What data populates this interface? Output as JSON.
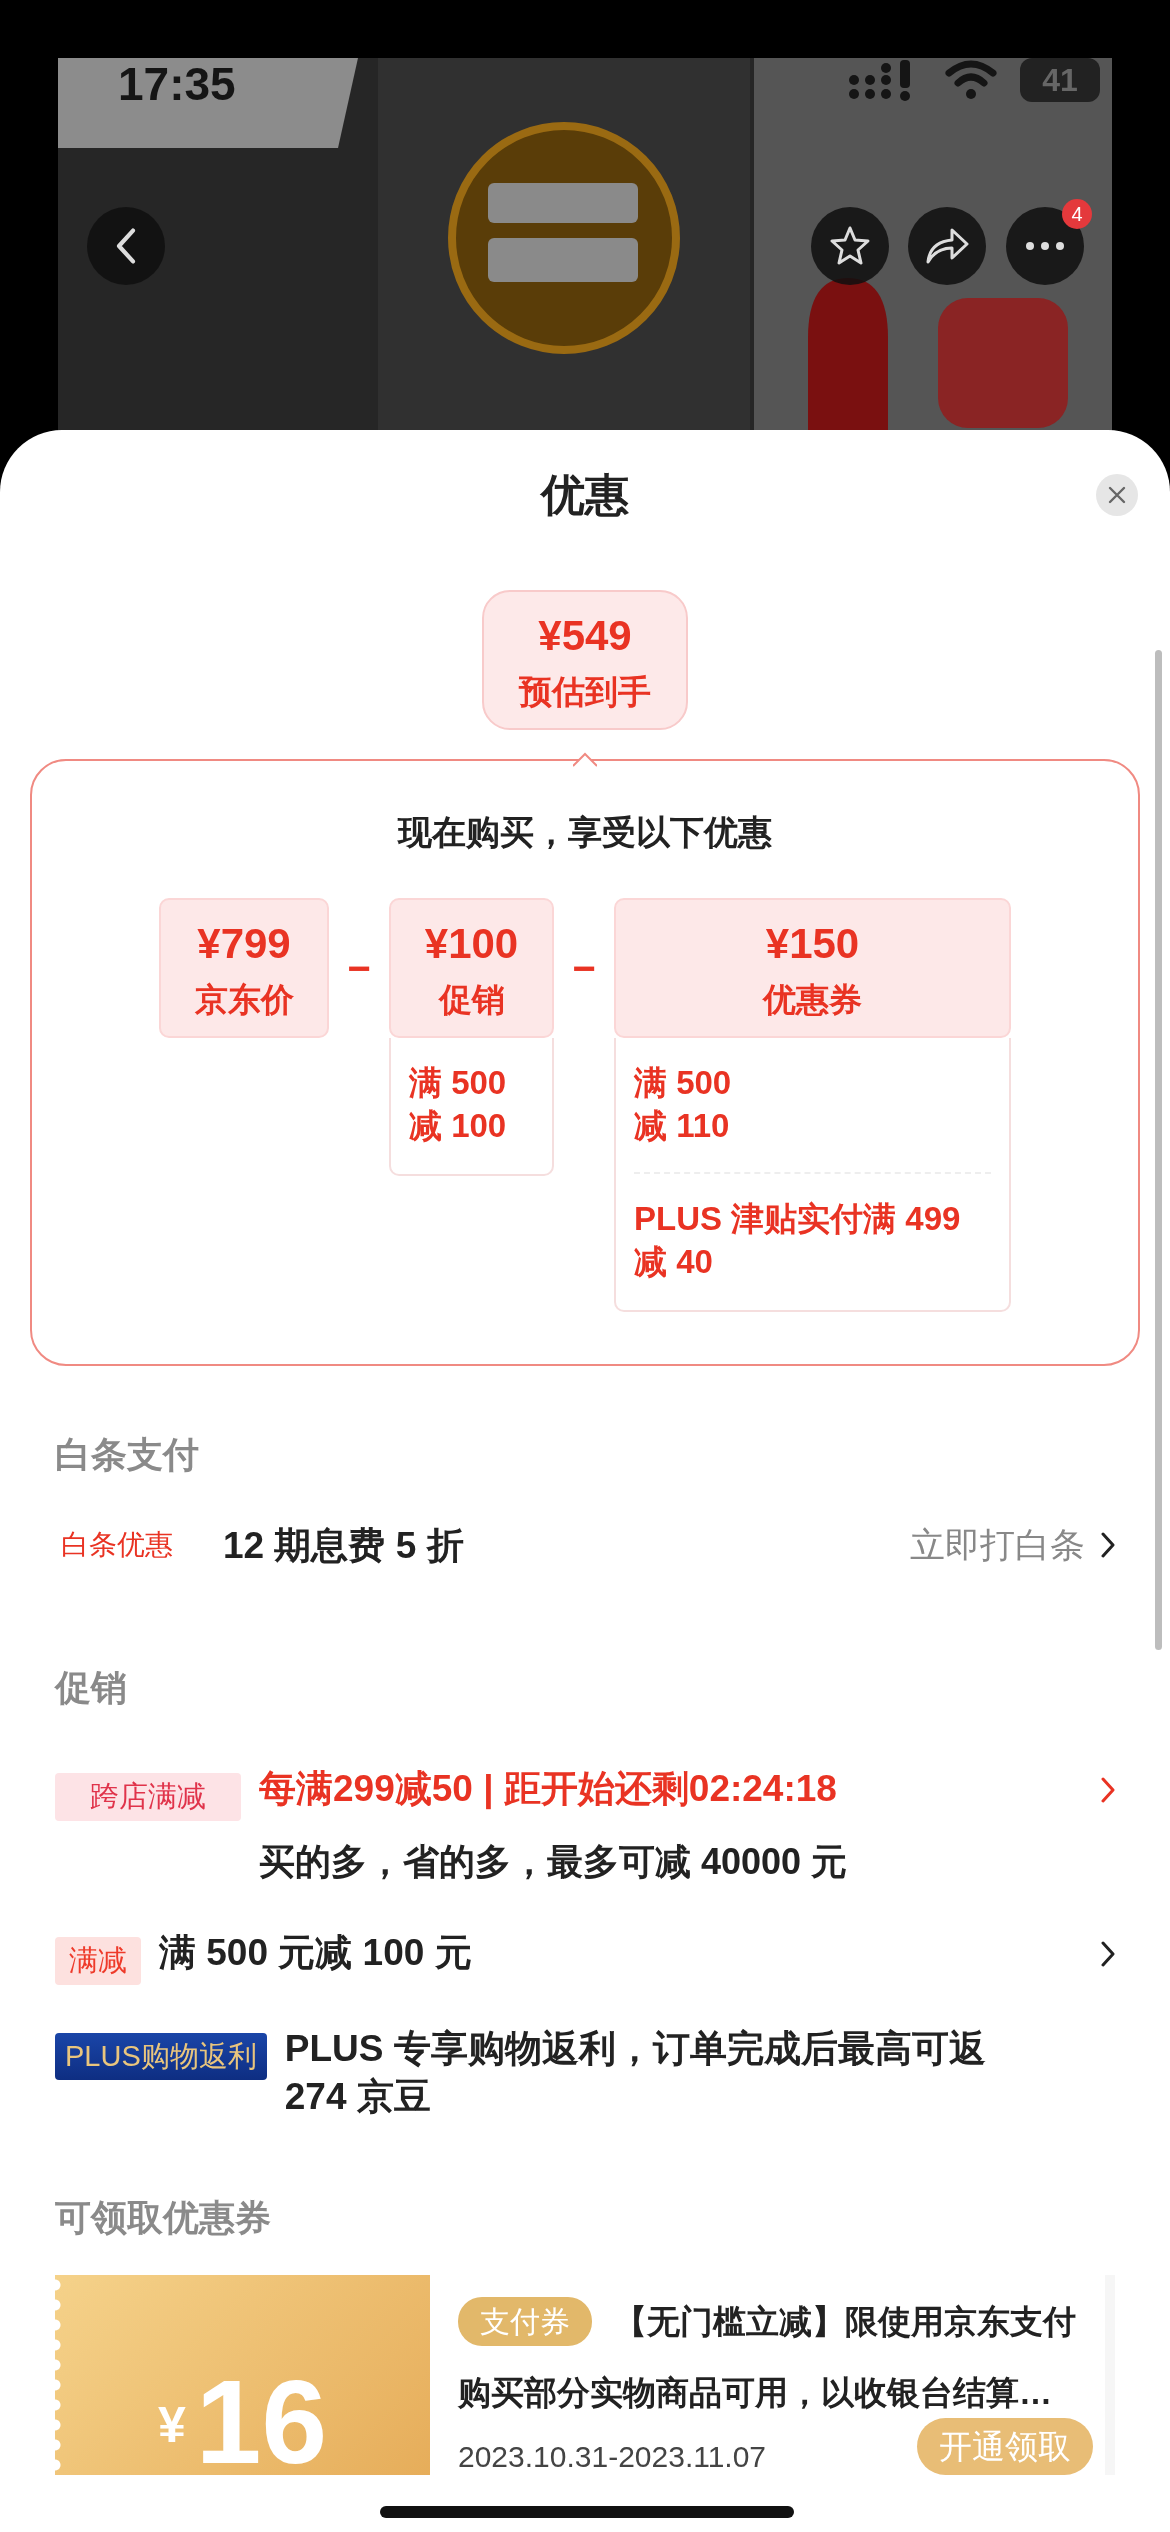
{
  "status_bar": {
    "time": "17:35",
    "battery": "41"
  },
  "header": {
    "more_badge": "4"
  },
  "sheet": {
    "title": "优惠"
  },
  "estimate": {
    "price": "¥549",
    "label": "预估到手"
  },
  "breakdown": {
    "heading": "现在购买，享受以下优惠",
    "items": [
      {
        "price": "¥799",
        "label": "京东价"
      },
      {
        "operator": "−",
        "price": "¥100",
        "label": "促销",
        "conditions": [
          "满 500\n减 100"
        ]
      },
      {
        "operator": "−",
        "price": "¥150",
        "label": "优惠券",
        "conditions": [
          "满 500\n减 110",
          "PLUS 津贴实付满 499\n减 40"
        ]
      }
    ]
  },
  "baitiao": {
    "heading": "白条支付",
    "tag": "白条优惠",
    "text": "12 期息费 5 折",
    "link": "立即打白条"
  },
  "promotions": {
    "heading": "促销",
    "items": [
      {
        "kind": "cross_store",
        "tag": "跨店满减",
        "title": "每满299减50 | 距开始还剩02:24:18",
        "subtitle": "买的多，省的多，最多可减 40000 元",
        "arrow": true
      },
      {
        "kind": "discount",
        "tag": "满减",
        "title": "满 500 元减 100 元",
        "arrow": true
      },
      {
        "kind": "plus",
        "tag": "PLUS购物返利",
        "title": "PLUS 专享购物返利，订单完成后最高可返\n274 京豆",
        "arrow": false
      }
    ]
  },
  "coupons": {
    "heading": "可领取优惠券",
    "items": [
      {
        "currency": "¥",
        "amount": "16",
        "tag": "支付券",
        "title": "【无门槛立减】限使用京东支付",
        "description": "购买部分实物商品可用，以收银台结算…",
        "validity": "2023.10.31-2023.11.07",
        "button": "开通领取"
      }
    ]
  }
}
